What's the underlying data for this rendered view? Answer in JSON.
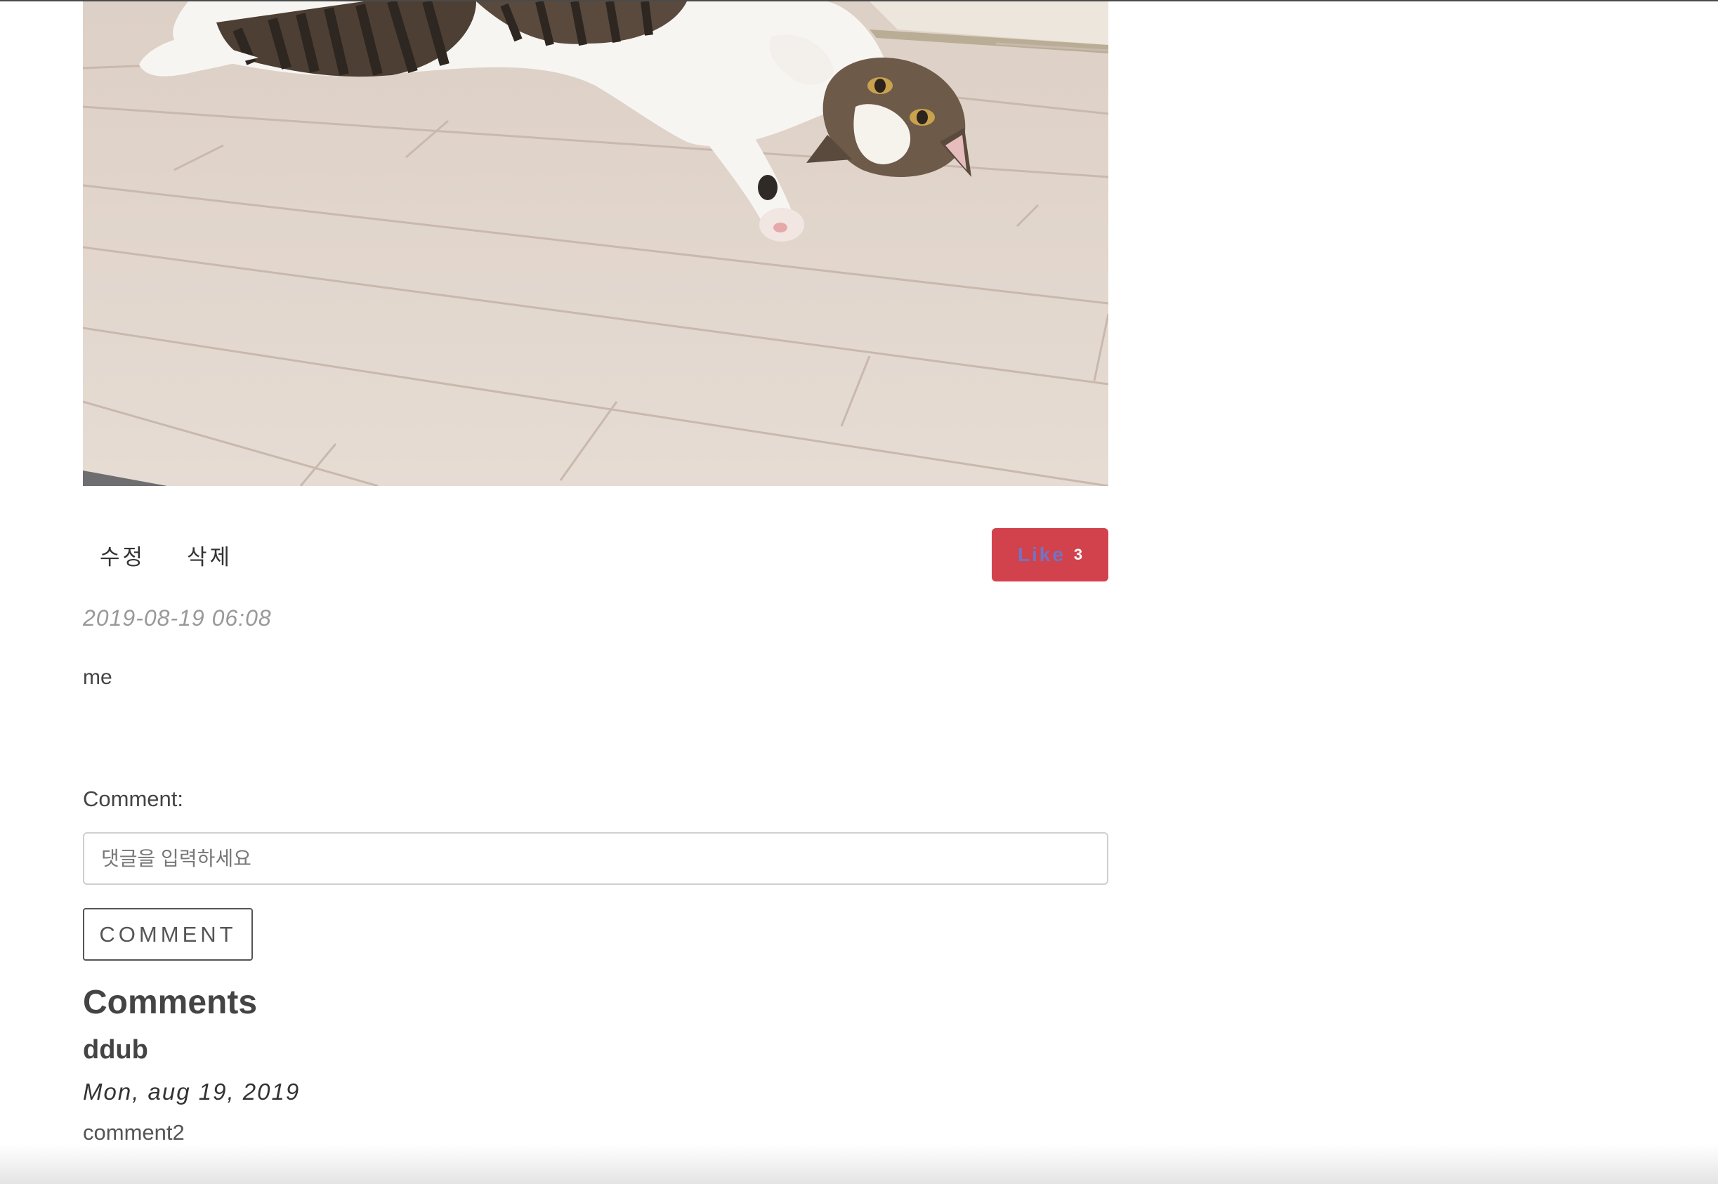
{
  "post": {
    "image_subject": "cat lying on wooden floor",
    "edit_label": "수정",
    "delete_label": "삭제",
    "like_label": "Like",
    "like_count": "3",
    "date": "2019-08-19 06:08",
    "body": "me"
  },
  "comment_form": {
    "label": "Comment:",
    "placeholder": "댓글을 입력하세요",
    "submit_label": "COMMENT"
  },
  "comments": {
    "heading": "Comments",
    "items": [
      {
        "author": "ddub",
        "date": "Mon, aug 19, 2019",
        "text": "comment2"
      }
    ]
  },
  "colors": {
    "like_button": "#d2424d",
    "like_label": "#6f74c6",
    "text": "#444444",
    "muted_date": "#999999"
  }
}
